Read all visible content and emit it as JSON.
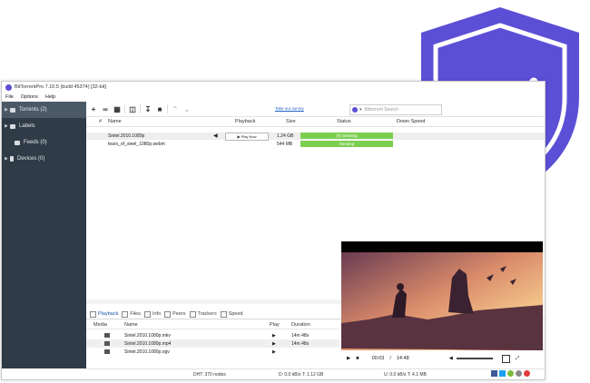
{
  "window": {
    "title": "BitTorrentPro 7.10.5 (build 45374) [32-bit]",
    "menus": [
      "File",
      "Options",
      "Help"
    ]
  },
  "sidebar": {
    "items": [
      {
        "label": "Torrents (2)",
        "active": true
      },
      {
        "label": "Labels",
        "active": false
      },
      {
        "label": "Feeds (0)",
        "active": false
      },
      {
        "label": "Devices (0)",
        "active": false
      }
    ]
  },
  "toolbar": {
    "link": "Take our survey",
    "search_placeholder": "Bittorrent Search"
  },
  "torrent_table": {
    "columns": [
      "#",
      "Name",
      "Playback",
      "Size",
      "Status",
      "Down Speed"
    ],
    "rows": [
      {
        "name": "Sintel.2010.1080p",
        "playback": "Play Now",
        "size": "1.24 GB",
        "status": "(0) Seeding"
      },
      {
        "name": "tears_of_steel_1080p.webm",
        "playback": "",
        "size": "544 MB",
        "status": "Seeding"
      }
    ]
  },
  "detail_tabs": [
    "Playback",
    "Files",
    "Info",
    "Peers",
    "Trackers",
    "Speed"
  ],
  "media_list": {
    "columns": [
      "Media",
      "Name",
      "Play",
      "Duration"
    ],
    "rows": [
      {
        "name": "Sintel.2010.1080p.mkv",
        "duration": "14m 48s"
      },
      {
        "name": "Sintel.2010.1080p.mp4",
        "duration": "14m 48s"
      },
      {
        "name": "Sintel.2010.1080p.ogv",
        "duration": ""
      }
    ]
  },
  "player": {
    "current_time": "00:03",
    "separator": "/",
    "total_time": "14:48"
  },
  "statusbar": {
    "dht": "DHT: 370 nodes",
    "down": "D: 0.0 kB/s T: 1.12 GB",
    "up": "U: 0.0 kB/s T: 4.1 MB"
  },
  "colors": {
    "shield": "#5b4fd6",
    "seeding": "#7ccf4e",
    "sidebar": "#2f3b46"
  }
}
